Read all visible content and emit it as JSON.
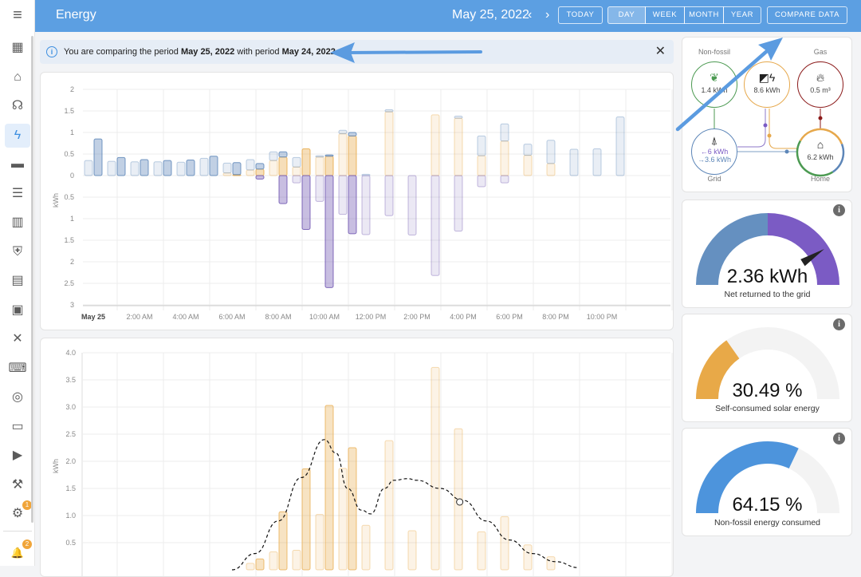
{
  "header": {
    "title": "Energy",
    "date": "May 25, 2022",
    "prev_icon": "chevron-left-icon",
    "next_icon": "chevron-right-icon",
    "today_label": "TODAY",
    "periods": [
      "DAY",
      "WEEK",
      "MONTH",
      "YEAR"
    ],
    "active_period": "DAY",
    "compare_label": "COMPARE DATA"
  },
  "sidebar": {
    "items": [
      {
        "id": "overview",
        "glyph": "▦"
      },
      {
        "id": "home",
        "glyph": "⌂"
      },
      {
        "id": "assist",
        "glyph": "☊"
      },
      {
        "id": "energy",
        "glyph": "ϟ",
        "active": true
      },
      {
        "id": "presenter",
        "glyph": "▬"
      },
      {
        "id": "logbook",
        "glyph": "☰"
      },
      {
        "id": "history",
        "glyph": "▥"
      },
      {
        "id": "security",
        "glyph": "⛨"
      },
      {
        "id": "devices",
        "glyph": "▤"
      },
      {
        "id": "hacs",
        "glyph": "▣"
      },
      {
        "id": "vscode",
        "glyph": "✕"
      },
      {
        "id": "terminal",
        "glyph": "⌨"
      },
      {
        "id": "zigbee",
        "glyph": "◎"
      },
      {
        "id": "calendar",
        "glyph": "▭"
      },
      {
        "id": "media",
        "glyph": "▶"
      },
      {
        "id": "developer-tools",
        "glyph": "⚒"
      },
      {
        "id": "settings",
        "glyph": "⚙",
        "badge": "1"
      }
    ],
    "notifications": {
      "glyph": "🔔",
      "badge": "2"
    }
  },
  "banner": {
    "prefix": "You are comparing the period ",
    "period": "May 25, 2022",
    "middle": " with period ",
    "compare_period": "May 24, 2022"
  },
  "distribution": {
    "nonfossil": {
      "label": "Non-fossil",
      "value": "1.4 kWh",
      "color": "#4c9a52"
    },
    "solar": {
      "value": "8.6 kWh",
      "color": "#e6a84c"
    },
    "gas": {
      "label": "Gas",
      "value": "0.5 m³",
      "color": "#8b1a1a"
    },
    "grid": {
      "label": "Grid",
      "from": "←6 kWh",
      "to": "→3.6 kWh",
      "color": "#5d86b8"
    },
    "home": {
      "label": "Home",
      "value": "6.2 kWh"
    }
  },
  "gauges": [
    {
      "value": "2.36 kWh",
      "label": "Net returned to the grid",
      "level": 0.82,
      "colors": [
        "#6590c0",
        "#7b5bc4"
      ]
    },
    {
      "value": "30.49 %",
      "label": "Self-consumed solar energy",
      "level": 0.3049,
      "color": "#e8a948"
    },
    {
      "value": "64.15 %",
      "label": "Non-fossil energy consumed",
      "level": 0.6415,
      "color": "#4d94dc"
    }
  ],
  "chart_data": [
    {
      "type": "bar",
      "ylabel": "kWh",
      "ylim": [
        -3,
        2
      ],
      "yticks": [
        "2",
        "1.5",
        "1",
        "0.5",
        "0",
        "0.5",
        "1",
        "1.5",
        "2",
        "2.5",
        "3"
      ],
      "xticks": [
        "May 25",
        "2:00 AM",
        "4:00 AM",
        "6:00 AM",
        "8:00 AM",
        "10:00 AM",
        "12:00 PM",
        "2:00 PM",
        "4:00 PM",
        "6:00 PM",
        "8:00 PM",
        "10:00 PM"
      ],
      "grid": true,
      "colors": {
        "solar": "#e8a948",
        "grid": "#5d86b8",
        "return": "#6f55b0"
      },
      "series": {
        "current_solar": [
          0,
          0,
          0,
          0,
          0,
          0,
          0.02,
          0.15,
          0.43,
          0.62,
          0.45,
          0.92
        ],
        "current_grid": [
          0.85,
          0.42,
          0.37,
          0.35,
          0.36,
          0.45,
          0.28,
          0.13,
          0.12,
          0,
          0.03,
          0.08
        ],
        "current_return": [
          0,
          0,
          0,
          0,
          0,
          0,
          0,
          0.08,
          0.65,
          1.25,
          2.6,
          1.35
        ],
        "compare_solar": [
          0,
          0,
          0,
          0,
          0,
          0,
          0.06,
          0.13,
          0.35,
          0.2,
          0.43,
          0.97,
          0,
          1.48,
          0,
          1.41,
          1.33,
          0.46,
          0.8,
          0.47,
          0.28,
          0,
          0,
          0
        ],
        "compare_grid": [
          0.35,
          0.33,
          0.32,
          0.32,
          0.31,
          0.4,
          0.23,
          0.24,
          0.2,
          0.22,
          0.03,
          0.08,
          0.03,
          0.05,
          0,
          0,
          0.05,
          0.46,
          0.4,
          0.26,
          0.54,
          0.61,
          0.62,
          1.36
        ],
        "compare_return": [
          0,
          0,
          0,
          0,
          0,
          0,
          0,
          0,
          0,
          0.17,
          0.6,
          0.9,
          1.37,
          0.93,
          1.38,
          2.32,
          1.29,
          0.26,
          0.17,
          0,
          0,
          0,
          0,
          0
        ]
      }
    },
    {
      "type": "bar",
      "ylabel": "kWh",
      "ylim": [
        0,
        4
      ],
      "yticks": [
        "4.0",
        "3.5",
        "3.0",
        "2.5",
        "2.0",
        "1.5",
        "1.0",
        "0.5"
      ],
      "grid": true,
      "series": {
        "current_solar": [
          0,
          0,
          0,
          0,
          0,
          0,
          0,
          0.2,
          1.07,
          1.86,
          3.03,
          2.25
        ],
        "compare_solar": [
          0,
          0,
          0,
          0,
          0,
          0,
          0,
          0.12,
          0.33,
          0.36,
          1.02,
          1.87,
          0.82,
          2.38,
          0.72,
          3.73,
          2.6,
          0.7,
          0.98,
          0.46,
          0.24,
          0,
          0,
          0
        ],
        "forecast": [
          [
            6,
            0
          ],
          [
            7,
            0.3
          ],
          [
            8,
            0.9
          ],
          [
            9,
            1.7
          ],
          [
            10,
            2.4
          ],
          [
            10.5,
            2.15
          ],
          [
            11,
            1.5
          ],
          [
            11.6,
            1.1
          ],
          [
            12,
            1.03
          ],
          [
            12.6,
            1.5
          ],
          [
            13,
            1.65
          ],
          [
            13.6,
            1.68
          ],
          [
            14,
            1.65
          ],
          [
            15,
            1.5
          ],
          [
            16,
            1.28
          ],
          [
            17,
            0.9
          ],
          [
            18,
            0.55
          ],
          [
            19,
            0.3
          ],
          [
            20,
            0.15
          ],
          [
            21,
            0.04
          ]
        ]
      }
    }
  ]
}
